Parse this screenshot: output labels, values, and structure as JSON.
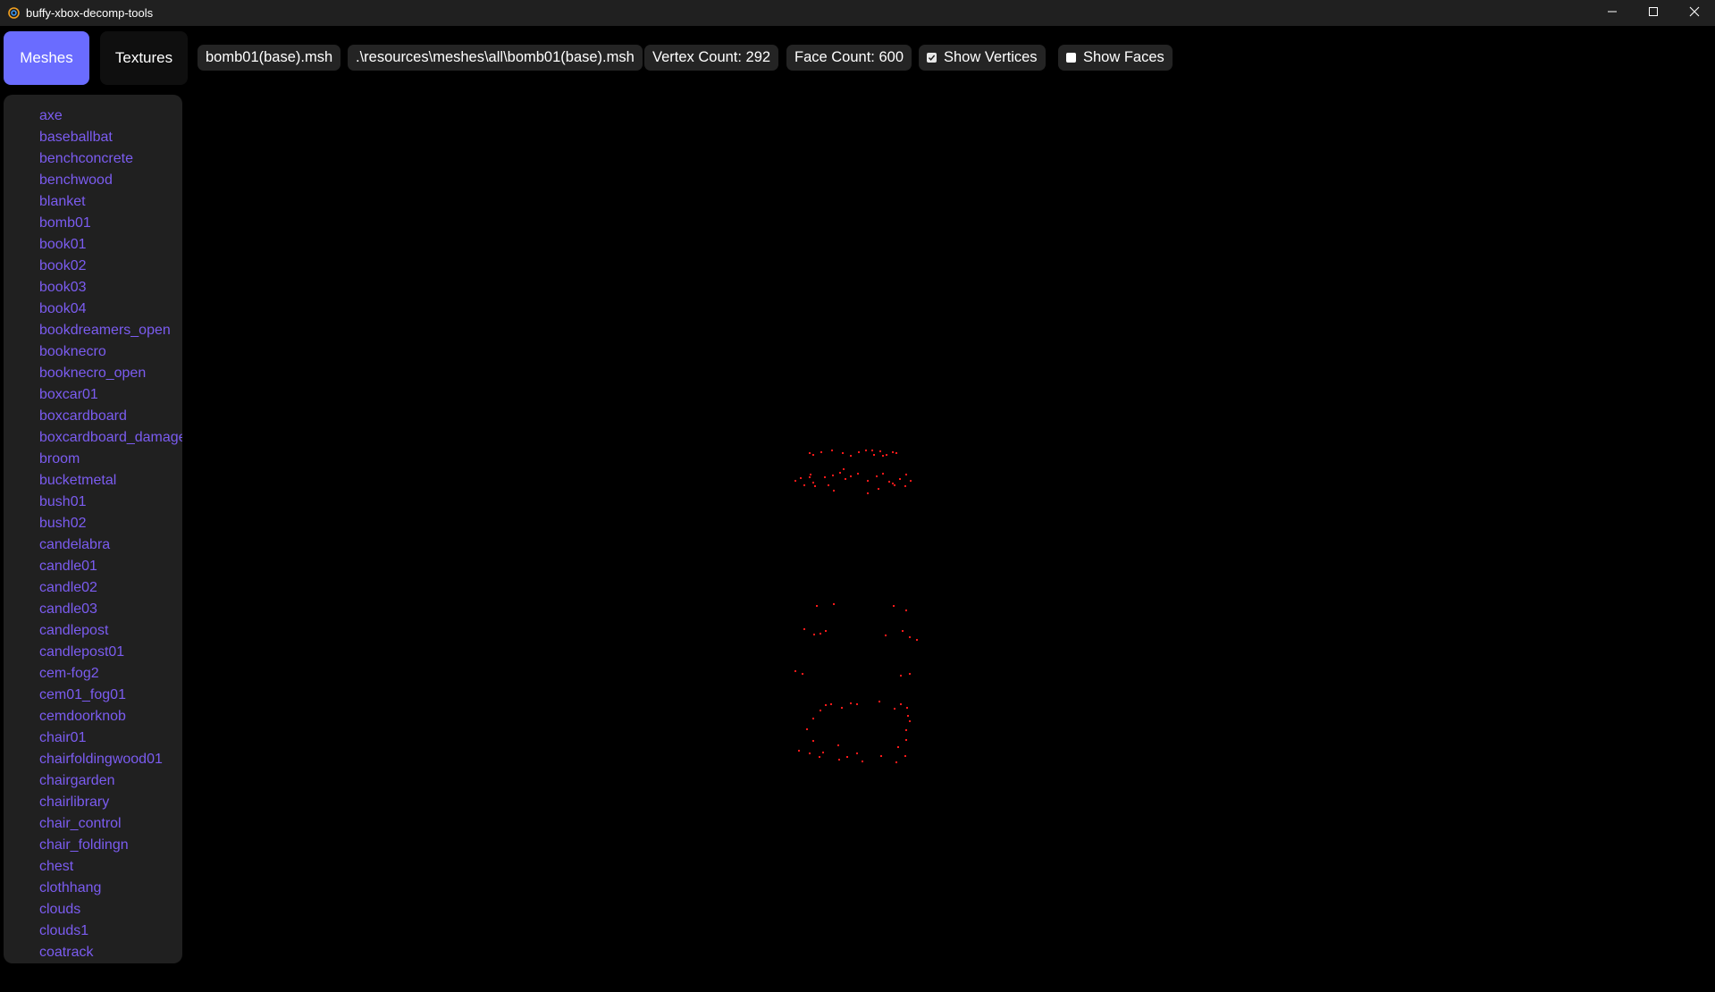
{
  "window": {
    "title": "buffy-xbox-decomp-tools",
    "icon": "app-link-icon",
    "controls": [
      "minimize-icon",
      "maximize-icon",
      "close-icon"
    ]
  },
  "tabs": [
    {
      "label": "Meshes",
      "active": true
    },
    {
      "label": "Textures",
      "active": false
    }
  ],
  "info": {
    "filename": "bomb01(base).msh",
    "path": ".\\resources\\meshes\\all\\bomb01(base).msh",
    "vertex_count": "Vertex Count: 292",
    "face_count": "Face Count: 600"
  },
  "toggles": {
    "show_vertices": {
      "label": "Show Vertices",
      "checked": true
    },
    "show_faces": {
      "label": "Show Faces",
      "checked": false
    }
  },
  "mesh_list": [
    "axe",
    "baseballbat",
    "benchconcrete",
    "benchwood",
    "blanket",
    "bomb01",
    "book01",
    "book02",
    "book03",
    "book04",
    "bookdreamers_open",
    "booknecro",
    "booknecro_open",
    "boxcar01",
    "boxcardboard",
    "boxcardboard_damage",
    "broom",
    "bucketmetal",
    "bush01",
    "bush02",
    "candelabra",
    "candle01",
    "candle02",
    "candle03",
    "candlepost",
    "candlepost01",
    "cem-fog2",
    "cem01_fog01",
    "cemdoorknob",
    "chair01",
    "chairfoldingwood01",
    "chairgarden",
    "chairlibrary",
    "chair_control",
    "chair_foldingn",
    "chest",
    "clothhang",
    "clouds",
    "clouds1",
    "coatrack"
  ],
  "colors": {
    "accent": "#6a6cff",
    "list_text": "#7b5cf0",
    "vertex": "#ff1a1a",
    "background": "#000000",
    "panel": "#202020",
    "pill": "#242424"
  }
}
